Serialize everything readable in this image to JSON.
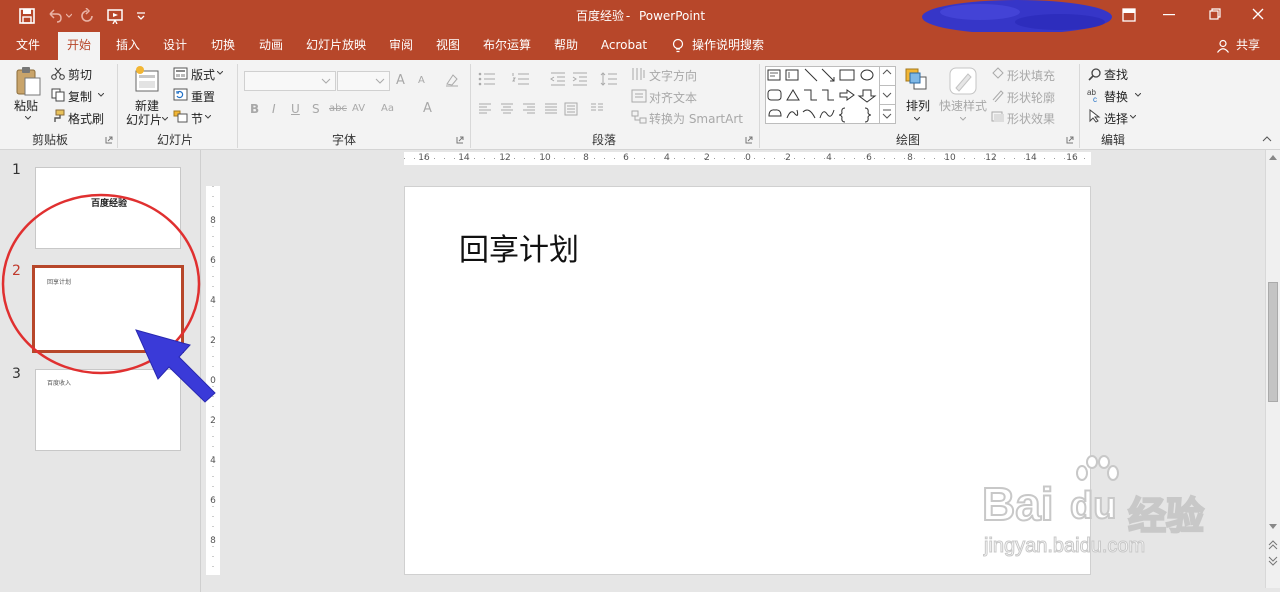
{
  "titlebar": {
    "doc_title": "百度经验",
    "separator": "-",
    "app_name": "PowerPoint"
  },
  "tabs": [
    "文件",
    "开始",
    "插入",
    "设计",
    "切换",
    "动画",
    "幻灯片放映",
    "审阅",
    "视图",
    "布尔运算",
    "帮助",
    "Acrobat",
    "操作说明搜索"
  ],
  "share_label": "共享",
  "ribbon": {
    "clipboard": {
      "paste": "粘贴",
      "cut": "剪切",
      "copy": "复制",
      "format_painter": "格式刷",
      "group": "剪贴板"
    },
    "slides": {
      "new_slide_line1": "新建",
      "new_slide_line2": "幻灯片",
      "layout": "版式",
      "reset": "重置",
      "section": "节",
      "group": "幻灯片"
    },
    "font": {
      "bold": "B",
      "italic": "I",
      "underline": "U",
      "shadow": "S",
      "strike": "abc",
      "spacing": "AV",
      "case": "Aa",
      "color": "A",
      "grow": "A",
      "shrink": "A",
      "group": "字体"
    },
    "paragraph": {
      "text_direction": "文字方向",
      "align_text": "对齐文本",
      "convert_smartart": "转换为 SmartArt",
      "group": "段落"
    },
    "drawing": {
      "arrange": "排列",
      "quick_styles": "快速样式",
      "shape_fill": "形状填充",
      "shape_outline": "形状轮廓",
      "shape_effects": "形状效果",
      "group": "绘图"
    },
    "editing": {
      "find": "查找",
      "replace": "替换",
      "select": "选择",
      "group": "编辑"
    }
  },
  "slides": [
    {
      "number": "1",
      "title": "百度经验"
    },
    {
      "number": "2",
      "title": "回享计划"
    },
    {
      "number": "3",
      "title": "百度收入"
    }
  ],
  "main_slide_title": "回享计划",
  "hruler_labels": [
    "16",
    "14",
    "12",
    "10",
    "8",
    "6",
    "4",
    "2",
    "0",
    "2",
    "4",
    "6",
    "8",
    "10",
    "12",
    "14",
    "16"
  ],
  "vruler_labels": [
    "8",
    "6",
    "4",
    "2",
    "0",
    "2",
    "4",
    "6",
    "8"
  ],
  "watermark": {
    "brand": "Bai",
    "brand_paw": "du",
    "suffix": "经验",
    "url": "jingyan.baidu.com"
  },
  "colors": {
    "accent": "#b7472a",
    "annotation_red": "#e03030",
    "annotation_blue": "#3a3ad8",
    "redaction": "#3636c8"
  }
}
